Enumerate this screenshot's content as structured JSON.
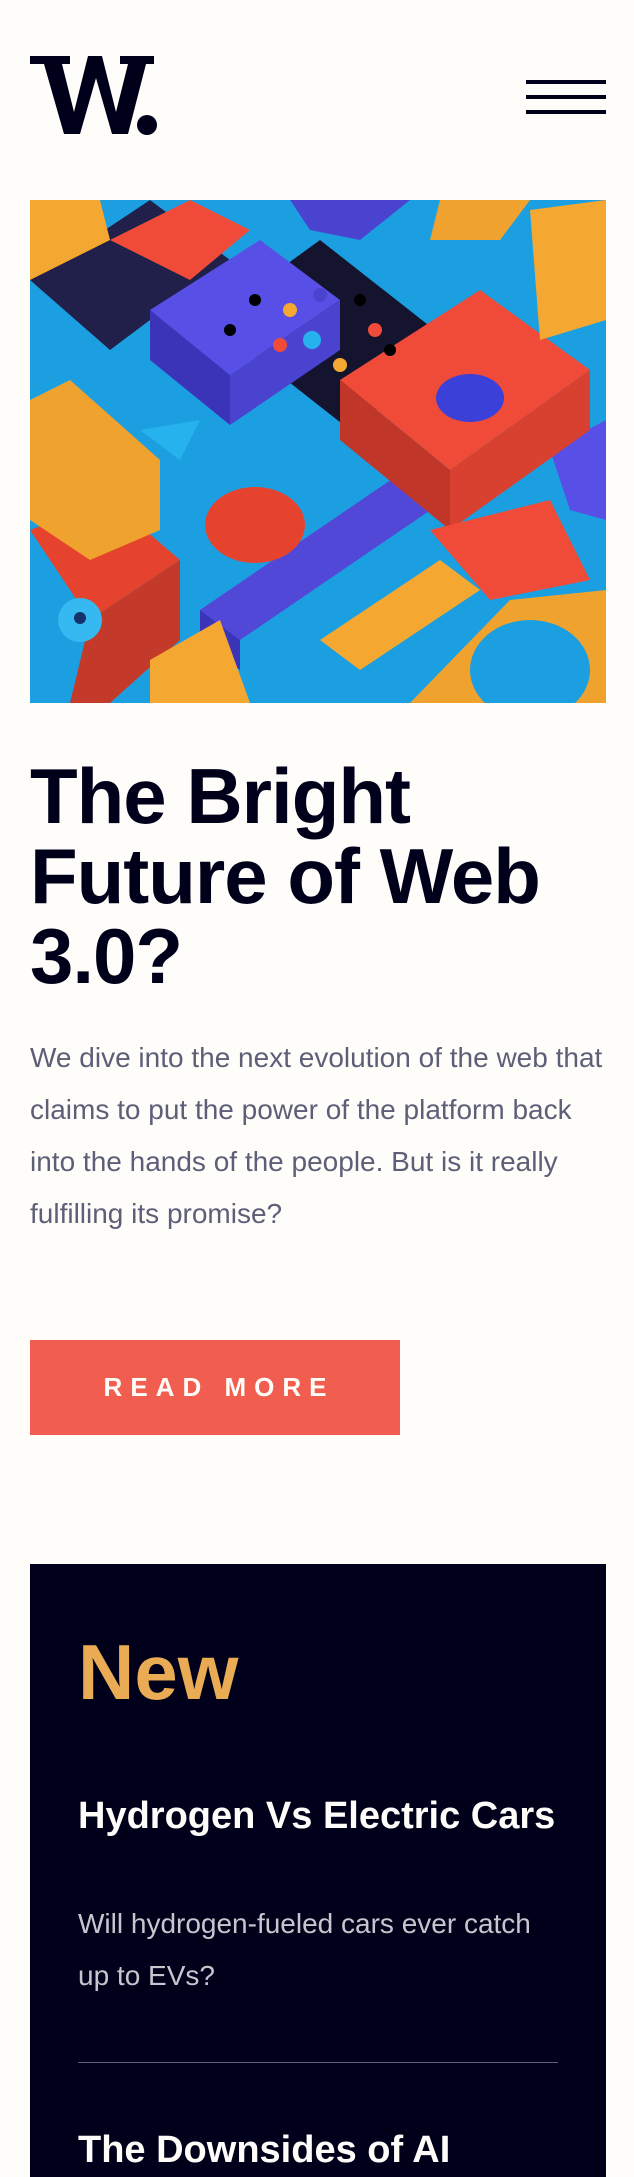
{
  "header": {
    "logo_icon": "w-logo-icon",
    "menu_icon": "hamburger-menu-icon"
  },
  "hero": {
    "image_icon": "abstract-3d-shapes-image",
    "title": "The Bright Future of Web 3.0?",
    "description": "We dive into the next evolution of the web that claims to put the power of the platform back into the hands of the people. But is it really fulfilling its promise?",
    "cta_label": "READ MORE"
  },
  "new_section": {
    "heading": "New",
    "items": [
      {
        "title": "Hydrogen Vs Electric Cars",
        "description": "Will hydrogen-fueled cars ever catch up to EVs?"
      },
      {
        "title": "The Downsides of AI"
      }
    ]
  },
  "colors": {
    "background": "#fffdfa",
    "text_dark": "#00001a",
    "text_muted": "#5d5f79",
    "accent_red": "#f15e50",
    "accent_gold": "#e9ab53",
    "panel_bg": "#00001a"
  }
}
